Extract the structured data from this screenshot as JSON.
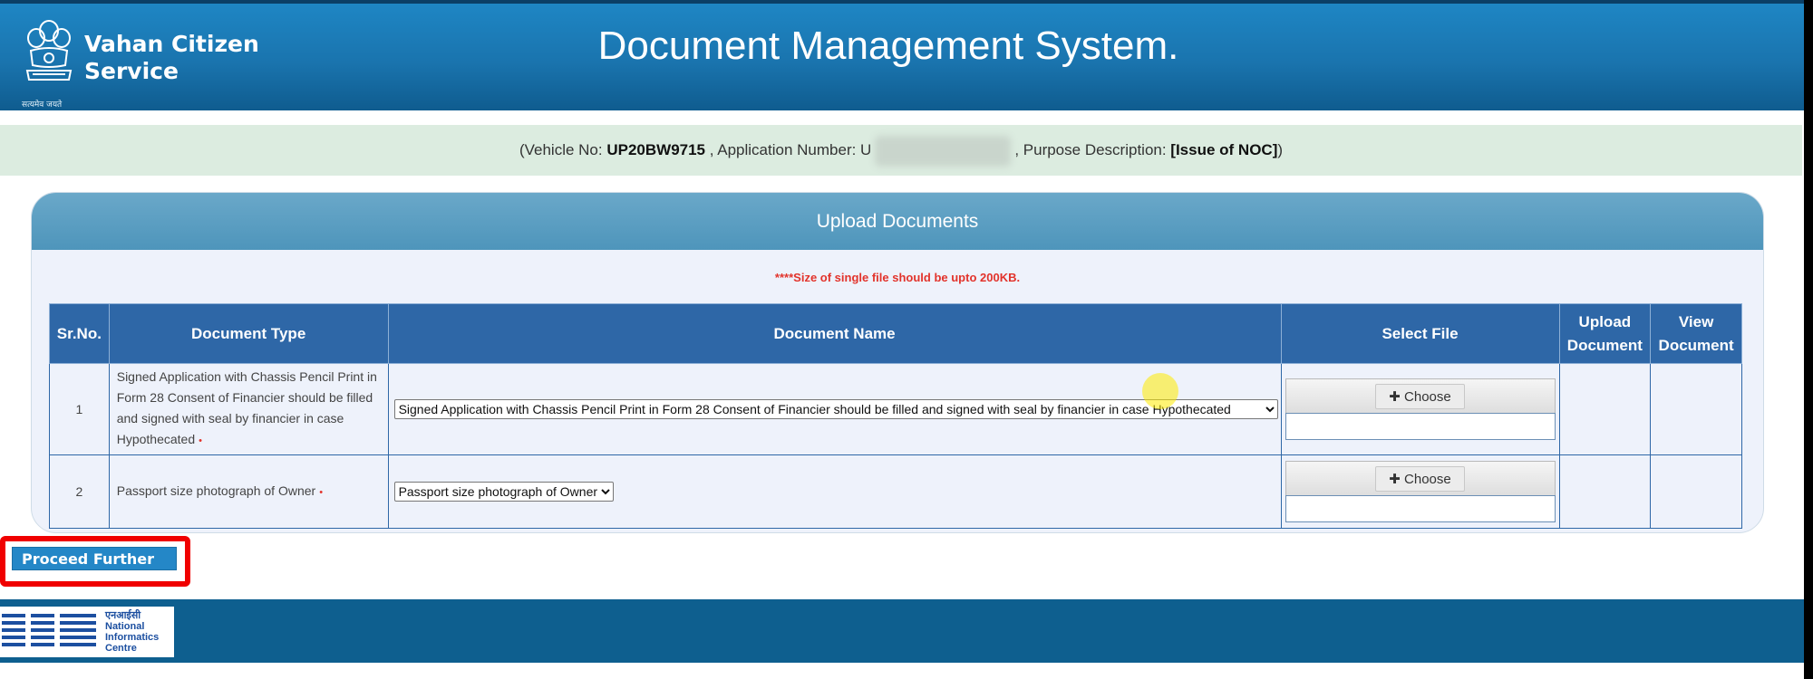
{
  "header": {
    "brand_line1": "Vahan Citizen",
    "brand_line2": "Service",
    "emblem_caption": "सत्यमेव जयते",
    "title": "Document Management System."
  },
  "info": {
    "prefix": "(Vehicle No: ",
    "vehicle_no": "UP20BW9715",
    "app_label": " , Application Number: ",
    "app_number_partial": "U",
    "purpose_label": ", Purpose Description: ",
    "purpose": "[Issue of NOC]",
    "suffix": ")"
  },
  "panel": {
    "title": "Upload Documents",
    "size_note": "****Size of single file should be upto 200KB."
  },
  "table": {
    "headers": {
      "sr": "Sr.No.",
      "doc_type": "Document Type",
      "doc_name": "Document Name",
      "select_file": "Select File",
      "upload_line1": "Upload",
      "upload_line2": "Document",
      "view_line1": "View",
      "view_line2": "Document"
    },
    "rows": [
      {
        "sr": "1",
        "doc_type": "Signed Application with Chassis Pencil Print in Form 28 Consent of Financier should be filled and signed with seal by financier in case Hypothecated",
        "doc_name": "Signed Application with Chassis Pencil Print in Form 28 Consent of Financier should be filled and signed with seal by financier in case Hypothecated",
        "choose_label": "Choose"
      },
      {
        "sr": "2",
        "doc_type": "Passport size photograph of Owner",
        "doc_name": "Passport size photograph of Owner",
        "choose_label": "Choose"
      }
    ],
    "required_marker": "•"
  },
  "actions": {
    "proceed_label": "Proceed Further"
  },
  "footer": {
    "nic_hindi": "एनआईसी",
    "nic_line1": "National",
    "nic_line2": "Informatics",
    "nic_line3": "Centre"
  },
  "colors": {
    "header_blue": "#1a74ae",
    "table_header": "#2e67a7",
    "warning_red": "#e2332b",
    "proceed_blue": "#2487c7",
    "highlight_box": "#f00000"
  }
}
